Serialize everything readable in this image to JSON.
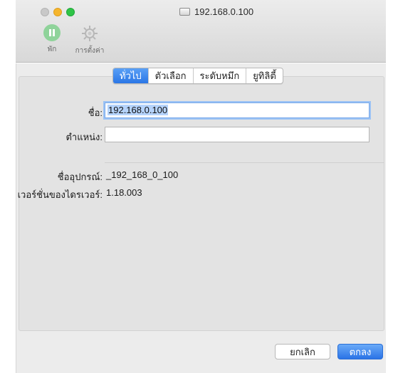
{
  "window": {
    "title": "192.168.0.100",
    "traffic_lights": [
      "close",
      "minimize",
      "zoom"
    ]
  },
  "toolbar": {
    "pause_label": "พัก",
    "settings_label": "การตั้งค่า"
  },
  "tabs": [
    {
      "label": "ทั่วไป",
      "active": true
    },
    {
      "label": "ตัวเลือก",
      "active": false
    },
    {
      "label": "ระดับหมึก",
      "active": false
    },
    {
      "label": "ยูทิลิตี้",
      "active": false
    }
  ],
  "form": {
    "name_label": "ชื่อ:",
    "name_value": "192.168.0.100",
    "location_label": "ตำแหน่ง:",
    "location_value": ""
  },
  "info": {
    "device_name_label": "ชื่ออุปกรณ์:",
    "device_name_value": "_192_168_0_100",
    "driver_version_label": "เวอร์ชั่นของไดรเวอร์:",
    "driver_version_value": "1.18.003"
  },
  "buttons": {
    "cancel": "ยกเลิก",
    "ok": "ตกลง"
  },
  "colors": {
    "accent": "#2a76e6",
    "pause_icon": "#8fd39a"
  },
  "icons": {
    "pause": "pause-circle-icon",
    "settings": "gear-icon",
    "window": "printer-drive-icon"
  }
}
